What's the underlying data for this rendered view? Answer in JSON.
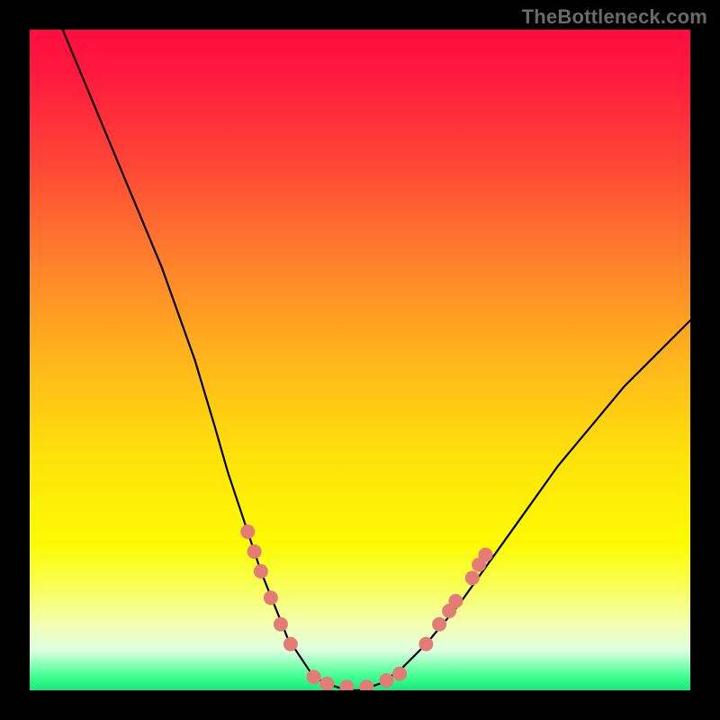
{
  "watermark": "TheBottleneck.com",
  "chart_data": {
    "type": "line",
    "title": "",
    "xlabel": "",
    "ylabel": "",
    "xlim": [
      0,
      100
    ],
    "ylim": [
      0,
      100
    ],
    "x": [
      5,
      10,
      15,
      20,
      25,
      28,
      30,
      33,
      35,
      37,
      39,
      41,
      43,
      45,
      48,
      50,
      53,
      56,
      60,
      65,
      70,
      75,
      80,
      85,
      90,
      95,
      100
    ],
    "values": [
      100,
      88,
      76,
      64,
      50,
      40,
      33,
      24,
      18,
      13,
      8,
      5,
      2,
      1,
      0,
      0,
      1,
      3,
      7,
      13,
      20,
      27,
      34,
      40,
      46,
      51,
      56
    ],
    "series": [
      {
        "name": "bottleneck-curve",
        "x": [
          5,
          10,
          15,
          20,
          25,
          28,
          30,
          33,
          35,
          37,
          39,
          41,
          43,
          45,
          48,
          50,
          53,
          56,
          60,
          65,
          70,
          75,
          80,
          85,
          90,
          95,
          100
        ],
        "y": [
          100,
          88,
          76,
          64,
          50,
          40,
          33,
          24,
          18,
          13,
          8,
          5,
          2,
          1,
          0,
          0,
          1,
          3,
          7,
          13,
          20,
          27,
          34,
          40,
          46,
          51,
          56
        ]
      }
    ],
    "markers": [
      {
        "x": 33,
        "y": 24
      },
      {
        "x": 34,
        "y": 21
      },
      {
        "x": 35,
        "y": 18
      },
      {
        "x": 36.5,
        "y": 14
      },
      {
        "x": 38,
        "y": 10
      },
      {
        "x": 39.5,
        "y": 7
      },
      {
        "x": 43,
        "y": 2
      },
      {
        "x": 45,
        "y": 1
      },
      {
        "x": 48,
        "y": 0.5
      },
      {
        "x": 51,
        "y": 0.5
      },
      {
        "x": 54,
        "y": 1.5
      },
      {
        "x": 56,
        "y": 2.5
      },
      {
        "x": 60,
        "y": 7
      },
      {
        "x": 62,
        "y": 10
      },
      {
        "x": 63.5,
        "y": 12
      },
      {
        "x": 64.5,
        "y": 13.5
      },
      {
        "x": 67,
        "y": 17
      },
      {
        "x": 68,
        "y": 19
      },
      {
        "x": 69,
        "y": 20.5
      }
    ],
    "background_gradient": {
      "top": "#ff0d3f",
      "mid": "#ffe309",
      "bottom": "#18e87f"
    }
  }
}
